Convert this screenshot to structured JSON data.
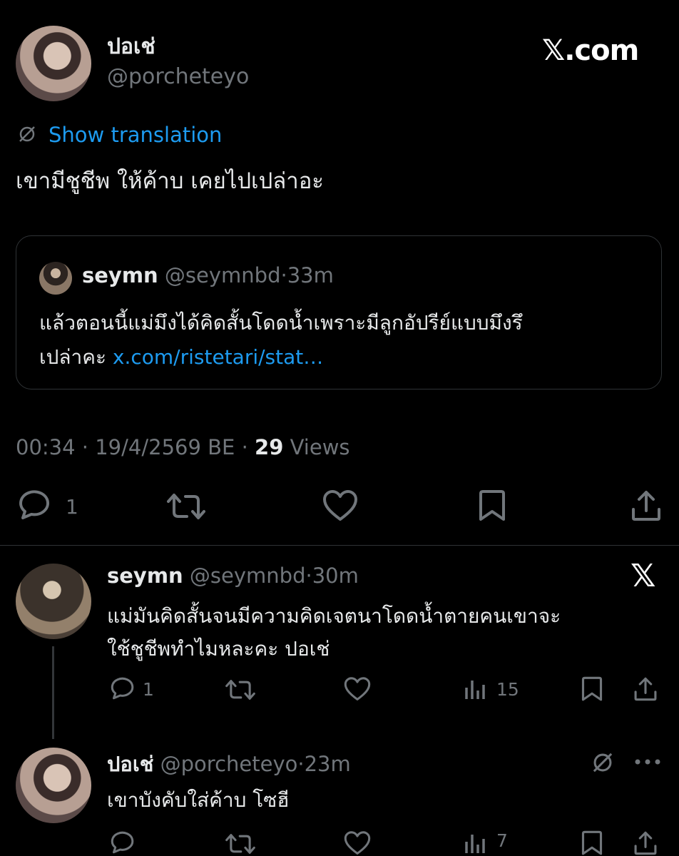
{
  "colors": {
    "background": "#000000",
    "text": "#e7e9ea",
    "muted": "#71767b",
    "link": "#1d9bf0",
    "border": "#2f3336"
  },
  "watermark": "𝕏.com",
  "main_post": {
    "display_name": "ปอเช่",
    "handle": "@porcheteyo",
    "show_translation": "Show translation",
    "text": "เขามีชูชีพ ให้ค้าบ เคยไปเปล่าอะ",
    "quote": {
      "display_name": "seymn",
      "handle": "@seymnbd",
      "dot": "·",
      "time": "33m",
      "text_line1": "แล้วตอนนี้แม่มึงได้คิดสั้นโดดน้ำเพราะมีลูกอัปรีย์แบบมึงรึ",
      "text_line2_prefix": "เปล่าคะ ",
      "link": "x.com/ristetari/stat…"
    },
    "meta": {
      "time": "00:34",
      "sep": "·",
      "date": "19/4/2569 BE",
      "views_count": "29",
      "views_label": "Views"
    },
    "actions": {
      "reply_count": "1"
    }
  },
  "reply1": {
    "display_name": "seymn",
    "handle": "@seymnbd",
    "dot": "·",
    "time": "30m",
    "text_line1": "แม่มันคิดสั้นจนมีความคิดเจตนาโดดน้ำตายคนเขาจะ",
    "text_line2": "ใช้ชูชีพทำไมหละคะ ปอเช่",
    "badge": "𝕏",
    "actions": {
      "reply_count": "1",
      "views_count": "15"
    }
  },
  "reply2": {
    "display_name": "ปอเช่",
    "handle": "@porcheteyo",
    "dot": "·",
    "time": "23m",
    "text": "เขาบังคับใส่ค้าบ โซฮี",
    "actions": {
      "views_count": "7"
    }
  }
}
